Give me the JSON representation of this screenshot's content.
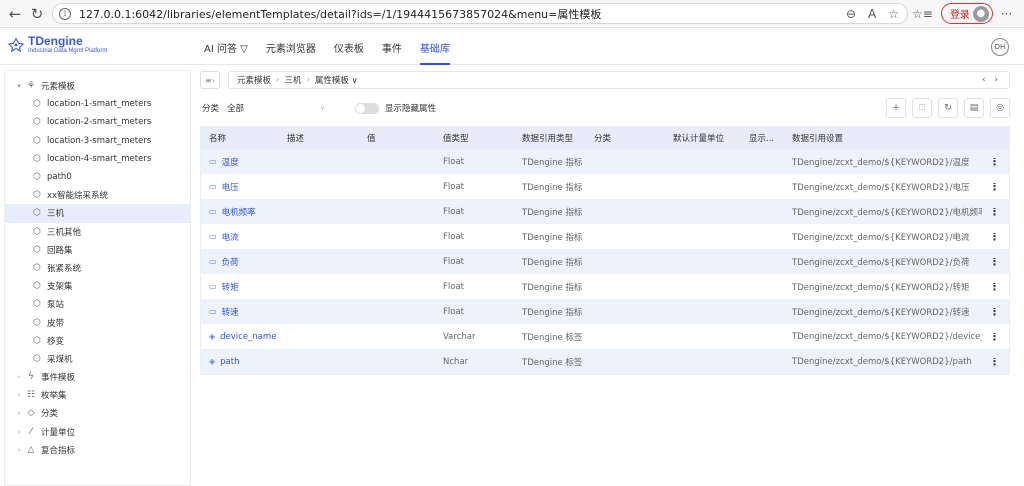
{
  "browser": {
    "url": "127.0.0.1:6042/libraries/elementTemplates/detail?ids=/1/1944415673857024&menu=属性模板",
    "login_label": "登录"
  },
  "app": {
    "logo_title": "TDengine",
    "logo_subtitle": "Industrial Data Mgmt Platform",
    "nav": [
      {
        "label": "AI 问答 ▽"
      },
      {
        "label": "元素浏览器"
      },
      {
        "label": "仪表板"
      },
      {
        "label": "事件"
      },
      {
        "label": "基础库"
      }
    ],
    "user_initials": "DH"
  },
  "sidebar": {
    "root": "元素模板",
    "items": [
      "location-1-smart_meters",
      "location-2-smart_meters",
      "location-3-smart_meters",
      "location-4-smart_meters",
      "path0",
      "xx智能综采系统",
      "三机",
      "三机其他",
      "回路集",
      "张紧系统",
      "支架集",
      "泵站",
      "皮带",
      "移变",
      "采煤机"
    ],
    "sections": [
      "事件模板",
      "枚举集",
      "分类",
      "计量单位",
      "复合指标"
    ]
  },
  "breadcrumb": {
    "items": [
      "元素模板",
      "三机",
      "属性模板 ∨"
    ]
  },
  "filter": {
    "label": "分类",
    "value": "全部",
    "toggle_label": "显示隐藏属性"
  },
  "table": {
    "headers": {
      "name": "名称",
      "desc": "描述",
      "value": "值",
      "value_type": "值类型",
      "ref_type": "数据引用类型",
      "category": "分类",
      "unit": "默认计量单位",
      "display": "显示...",
      "ref_setting": "数据引用设置"
    },
    "rows": [
      {
        "name": "温度",
        "icon": "▭",
        "value_type": "Float",
        "ref_type": "TDengine 指标",
        "ref_setting": "TDengine/zcxt_demo/${KEYWORD2}/温度"
      },
      {
        "name": "电压",
        "icon": "▭",
        "value_type": "Float",
        "ref_type": "TDengine 指标",
        "ref_setting": "TDengine/zcxt_demo/${KEYWORD2}/电压"
      },
      {
        "name": "电机频率",
        "icon": "▭",
        "value_type": "Float",
        "ref_type": "TDengine 指标",
        "ref_setting": "TDengine/zcxt_demo/${KEYWORD2}/电机频率"
      },
      {
        "name": "电流",
        "icon": "▭",
        "value_type": "Float",
        "ref_type": "TDengine 指标",
        "ref_setting": "TDengine/zcxt_demo/${KEYWORD2}/电流"
      },
      {
        "name": "负荷",
        "icon": "▭",
        "value_type": "Float",
        "ref_type": "TDengine 指标",
        "ref_setting": "TDengine/zcxt_demo/${KEYWORD2}/负荷"
      },
      {
        "name": "转矩",
        "icon": "▭",
        "value_type": "Float",
        "ref_type": "TDengine 指标",
        "ref_setting": "TDengine/zcxt_demo/${KEYWORD2}/转矩"
      },
      {
        "name": "转速",
        "icon": "▭",
        "value_type": "Float",
        "ref_type": "TDengine 指标",
        "ref_setting": "TDengine/zcxt_demo/${KEYWORD2}/转速"
      },
      {
        "name": "device_name",
        "icon": "◈",
        "value_type": "Varchar",
        "ref_type": "TDengine 标签",
        "ref_setting": "TDengine/zcxt_demo/${KEYWORD2}/device_..."
      },
      {
        "name": "path",
        "icon": "◈",
        "value_type": "Nchar",
        "ref_type": "TDengine 标签",
        "ref_setting": "TDengine/zcxt_demo/${KEYWORD2}/path"
      }
    ]
  }
}
